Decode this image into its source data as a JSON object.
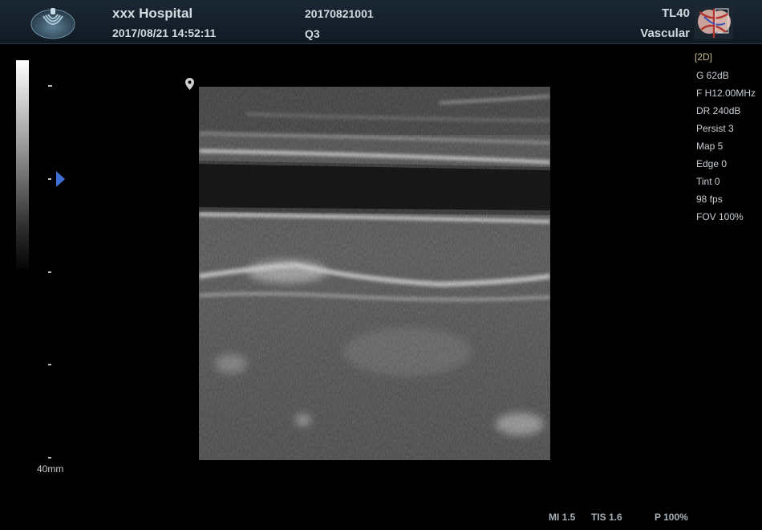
{
  "header": {
    "hospital": "xxx Hospital",
    "datetime": "2017/08/21 14:52:11",
    "patient_id": "20170821001",
    "exam_id": "Q3",
    "probe": "TL40",
    "preset": "Vascular"
  },
  "icons": {
    "logo": "ultrasound-logo-icon",
    "preset_thumbnail": "vascular-preset-thumbnail-icon",
    "focus": "focus-marker-icon",
    "pin": "location-pin-icon"
  },
  "colors": {
    "header_bg": "#14202c",
    "mode_label": "#c9b98a",
    "focus_marker": "#3e6fd6"
  },
  "scale": {
    "depth": "40mm"
  },
  "params": {
    "mode": "[2D]",
    "items": [
      "G 62dB",
      "F H12.00MHz",
      "DR 240dB",
      "Persist 3",
      "Map 5",
      "Edge 0",
      "Tint 0",
      "98 fps",
      "FOV 100%"
    ]
  },
  "indices": {
    "mi": "MI 1.5",
    "tis": "TIS 1.6",
    "power": "P 100%"
  }
}
